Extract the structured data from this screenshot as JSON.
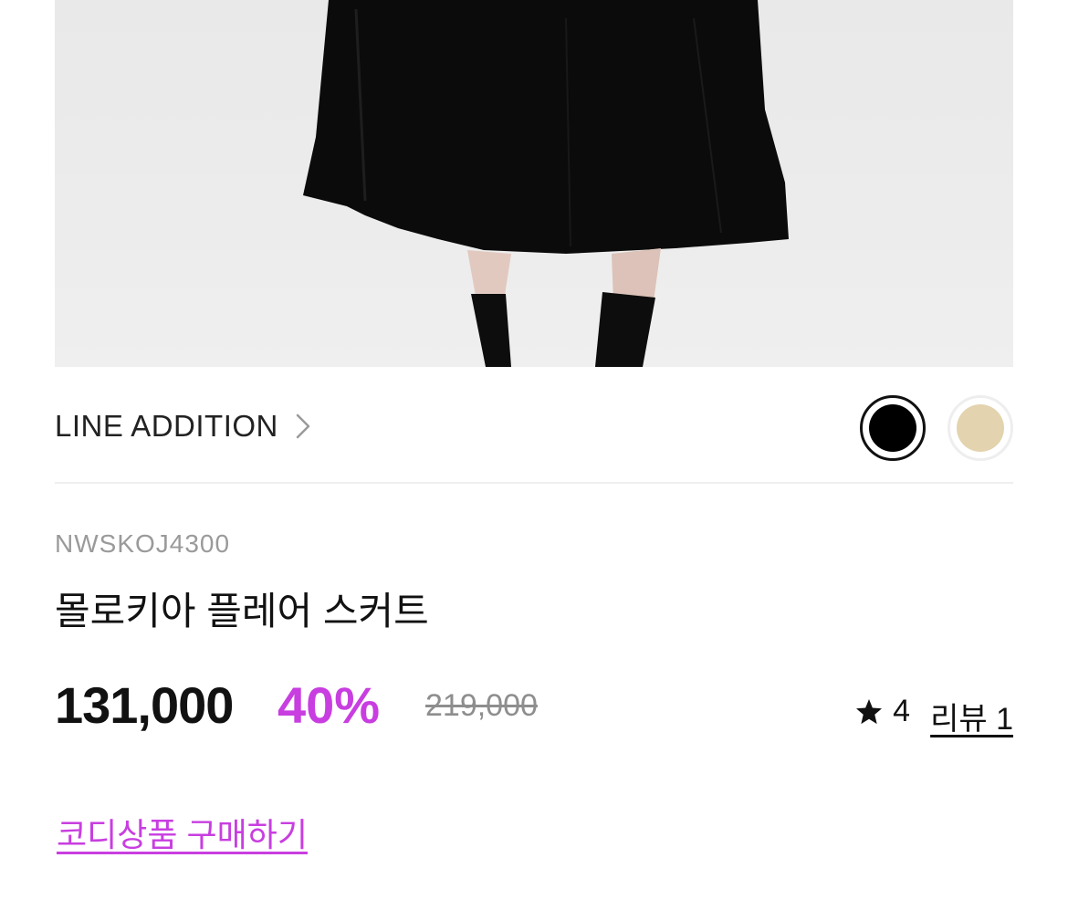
{
  "colors": {
    "accent": "#c83ee0",
    "swatch_black": "#000000",
    "swatch_beige": "#e3d3ae"
  },
  "product_image": {
    "icon": "product-photo-black-flare-skirt"
  },
  "brand": {
    "name": "LINE ADDITION",
    "icon": "chevron-right-icon"
  },
  "color_options": [
    {
      "color": "#000000",
      "selected": true
    },
    {
      "color": "#e3d3ae",
      "selected": false
    }
  ],
  "product": {
    "code": "NWSKOJ4300",
    "title": "몰로키아 플레어 스커트"
  },
  "price": {
    "sale": "131,000",
    "discount": "40%",
    "original": "219,000"
  },
  "rating": {
    "icon": "star-icon",
    "value": "4",
    "review_label": "리뷰 1"
  },
  "coordi": {
    "label": "코디상품 구매하기"
  }
}
